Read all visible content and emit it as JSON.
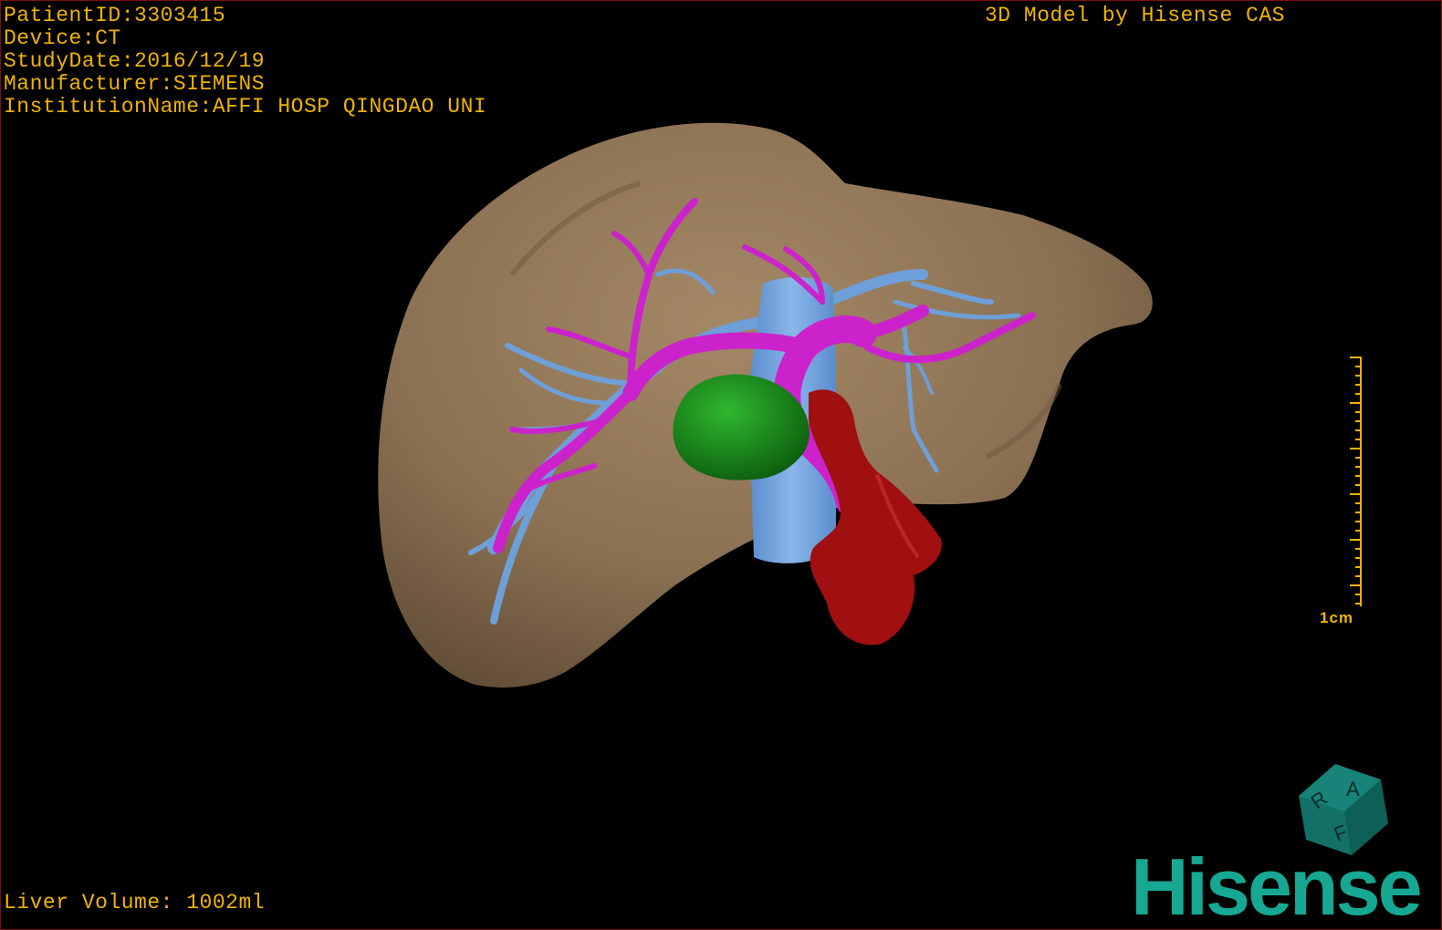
{
  "info": {
    "patient_id": "PatientID:3303415",
    "device": "Device:CT",
    "study_date": "StudyDate:2016/12/19",
    "manufacturer": "Manufacturer:SIEMENS",
    "institution": "InstitutionName:AFFI HOSP QINGDAO UNI"
  },
  "title": "3D Model by Hisense CAS",
  "liver_volume": "Liver Volume: 1002ml",
  "scale": {
    "label": "1cm"
  },
  "orientation_cube": {
    "letters": [
      "R",
      "A",
      "F"
    ]
  },
  "brand": {
    "logo_text": "Hisense"
  },
  "colors": {
    "overlay_text": "#f0b400",
    "liver": "#8b7152",
    "portal_vein": "#cc22cc",
    "hepatic_vein": "#6e9fd8",
    "tumor": "#1a8a1a",
    "artery": "#a01010",
    "brand": "#16a892",
    "cube": "#127066"
  }
}
